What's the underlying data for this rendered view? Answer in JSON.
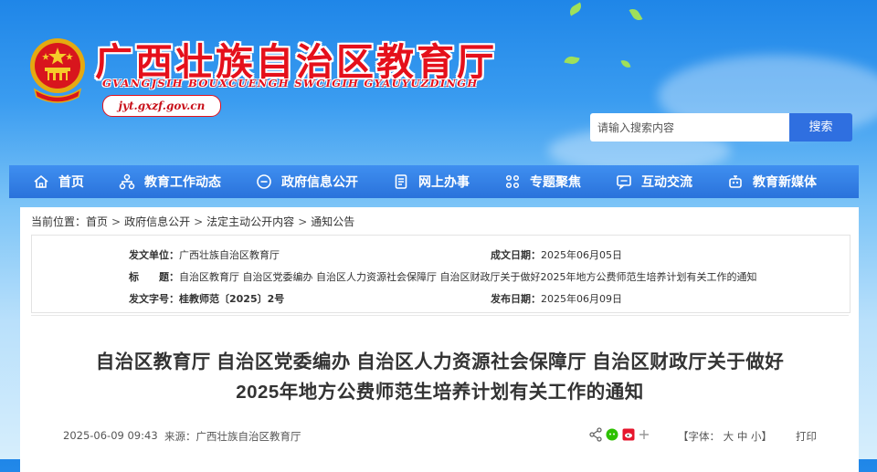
{
  "header": {
    "site_title": "广西壮族自治区教育厅",
    "site_subtitle": "GVANGJSIH BOUXCUENGH SWCIGIH GYAUYUZDINGH",
    "site_url": "jyt.gxzf.gov.cn",
    "search": {
      "placeholder": "请输入搜索内容",
      "button": "搜索"
    }
  },
  "nav": [
    {
      "label": "首页",
      "icon": "home-icon"
    },
    {
      "label": "教育工作动态",
      "icon": "org-chart-icon"
    },
    {
      "label": "政府信息公开",
      "icon": "chat-bubble-icon"
    },
    {
      "label": "网上办事",
      "icon": "document-icon"
    },
    {
      "label": "专题聚焦",
      "icon": "grid-dots-icon"
    },
    {
      "label": "互动交流",
      "icon": "message-icon"
    },
    {
      "label": "教育新媒体",
      "icon": "robot-icon"
    }
  ],
  "breadcrumb": {
    "prefix": "当前位置：",
    "items": [
      "首页",
      "政府信息公开",
      "法定主动公开内容",
      "通知公告"
    ],
    "separator": ">"
  },
  "meta": {
    "issuer_label": "发文单位：",
    "issuer": "广西壮族自治区教育厅",
    "date_label": "成文日期：",
    "date": "2025年06月05日",
    "title_label": "标　　题：",
    "title": "自治区教育厅 自治区党委编办 自治区人力资源社会保障厅 自治区财政厅关于做好2025年地方公费师范生培养计划有关工作的通知",
    "docnum_label": "发文字号：",
    "docnum": "桂教师范〔2025〕2号",
    "pubdate_label": "发布日期：",
    "pubdate": "2025年06月09日"
  },
  "article": {
    "title_line1": "自治区教育厅 自治区党委编办 自治区人力资源社会保障厅 自治区财政厅关于做好",
    "title_line2": "2025年地方公费师范生培养计划有关工作的通知",
    "datetime": "2025-06-09 09:43",
    "source_label": "来源：",
    "source": "广西壮族自治区教育厅",
    "font_label": "【字体：",
    "font_large": "大",
    "font_medium": "中",
    "font_small": "小",
    "font_close": "】",
    "print": "打印"
  },
  "colors": {
    "brand_red": "#e5101b",
    "nav_blue": "#2f7ae3",
    "search_btn": "#2f6fe0"
  }
}
